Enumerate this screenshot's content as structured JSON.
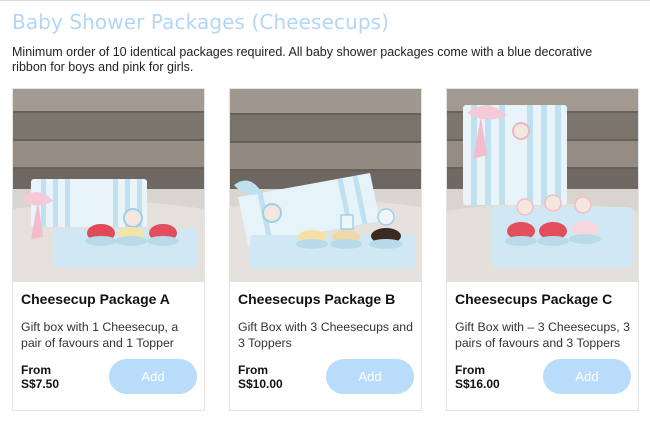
{
  "page": {
    "title": "Baby Shower Packages (Cheesecups)",
    "note": " Minimum order of 10 identical packages required. All baby shower packages come with a blue decorative ribbon for boys and pink for girls."
  },
  "colors": {
    "title": "#b3d6f7",
    "add_button": "#b9dcfa",
    "ribbon_pink": "#f6c9d8",
    "box_blue": "#cfe8f4"
  },
  "products": [
    {
      "name": "Cheesecup Package A",
      "description": "Gift box with 1 Cheesecup, a pair of favours and 1 Topper",
      "price_prefix": "From",
      "price": "S$7.50",
      "button": "Add"
    },
    {
      "name": "Cheesecups Package B",
      "description": "Gift Box with 3 Cheesecups and 3 Toppers",
      "price_prefix": "From",
      "price": "S$10.00",
      "button": "Add"
    },
    {
      "name": "Cheesecups Package C",
      "description": "Gift Box with – 3 Cheesecups, 3 pairs of favours and 3 Toppers",
      "price_prefix": "From",
      "price": "S$16.00",
      "button": "Add"
    }
  ]
}
